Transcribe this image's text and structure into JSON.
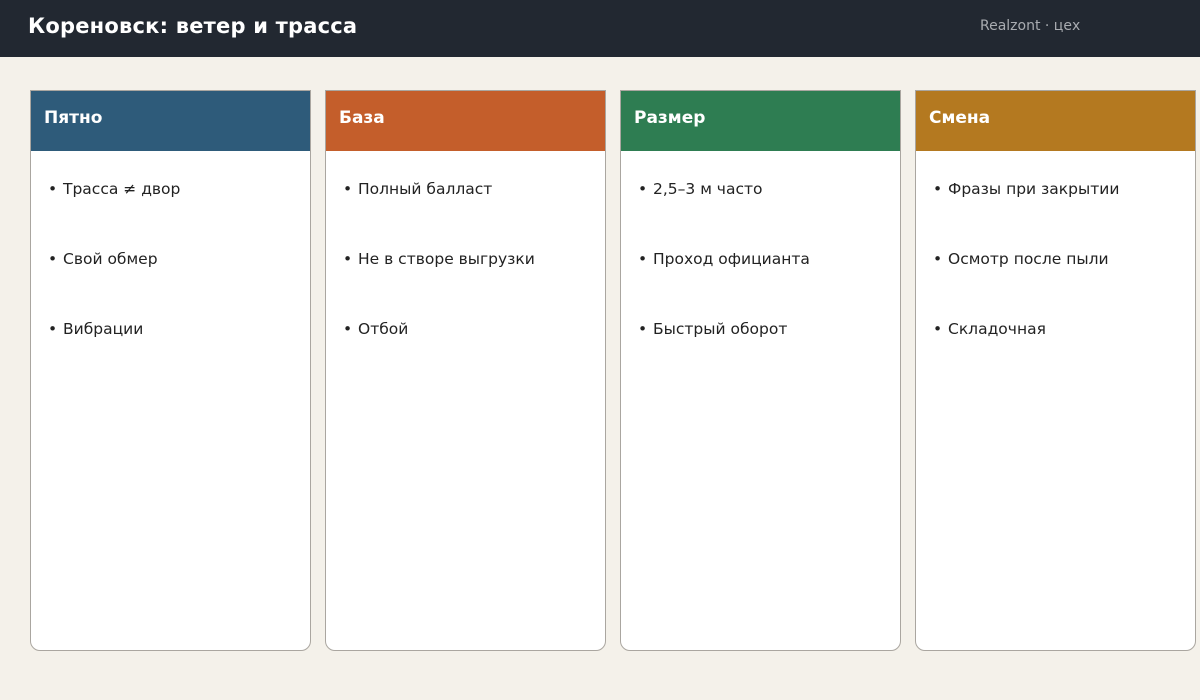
{
  "header": {
    "title": "Кореновск: ветер и трасса",
    "brand": "Realzont · цех"
  },
  "colors": {
    "topbar": "#222831",
    "background": "#f4f1ea"
  },
  "columns": [
    {
      "title": "Пятно",
      "color": "#2e5b7a",
      "items": [
        "Трасса ≠ двор",
        "Свой обмер",
        "Вибрации"
      ]
    },
    {
      "title": "База",
      "color": "#c45e2b",
      "items": [
        "Полный балласт",
        "Не в створе выгрузки",
        "Отбой"
      ]
    },
    {
      "title": "Размер",
      "color": "#2e7d52",
      "items": [
        "2,5–3 м часто",
        "Проход официанта",
        "Быстрый оборот"
      ]
    },
    {
      "title": "Смена",
      "color": "#b47920",
      "items": [
        "Фразы при закрытии",
        "Осмотр после пыли",
        "Складочная"
      ]
    }
  ]
}
